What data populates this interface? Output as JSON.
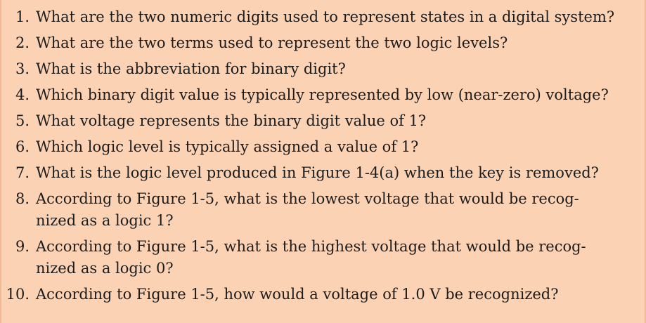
{
  "questions": [
    {
      "num": "1.",
      "lines": [
        "What are the two numeric digits used to represent states in a digital system?"
      ]
    },
    {
      "num": "2.",
      "lines": [
        "What are the two terms used to represent the two logic levels?"
      ]
    },
    {
      "num": "3.",
      "lines": [
        "What is the abbreviation for binary digit?"
      ]
    },
    {
      "num": "4.",
      "lines": [
        "Which binary digit value is typically represented by low (near-zero) voltage?"
      ]
    },
    {
      "num": "5.",
      "lines": [
        "What voltage represents the binary digit value of 1?"
      ]
    },
    {
      "num": "6.",
      "lines": [
        "Which logic level is typically assigned a value of 1?"
      ]
    },
    {
      "num": "7.",
      "lines": [
        "What is the logic level produced in Figure 1-4(a) when the key is removed?"
      ]
    },
    {
      "num": "8.",
      "lines": [
        "According to Figure 1-5, what is the lowest voltage that would be recog-",
        "nized as a logic 1?"
      ]
    },
    {
      "num": "9.",
      "lines": [
        "According to Figure 1-5, what is the highest voltage that would be recog-",
        "nized as a logic 0?"
      ]
    },
    {
      "num": "10.",
      "lines": [
        "According to Figure 1-5, how would a voltage of 1.0 V be recognized?"
      ]
    }
  ]
}
